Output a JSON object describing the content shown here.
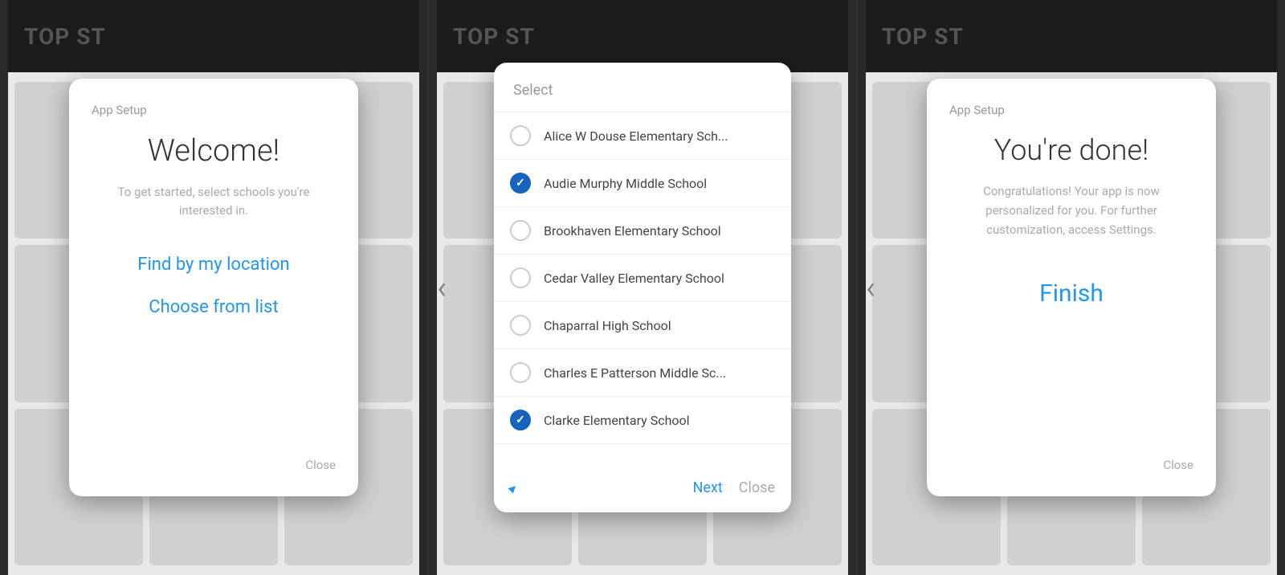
{
  "panel1": {
    "header": "App Setup",
    "title": "Welcome!",
    "subtitle": "To get started, select schools\nyou're interested in.",
    "find_location": "Find by my location",
    "choose_list": "Choose from list",
    "close": "Close"
  },
  "panel2": {
    "header": "Select",
    "schools": [
      {
        "name": "Alice W Douse Elementary Sch...",
        "checked": false
      },
      {
        "name": "Audie Murphy Middle School",
        "checked": true
      },
      {
        "name": "Brookhaven Elementary School",
        "checked": false
      },
      {
        "name": "Cedar Valley Elementary School",
        "checked": false
      },
      {
        "name": "Chaparral High School",
        "checked": false
      },
      {
        "name": "Charles E Patterson Middle Sc...",
        "checked": false
      },
      {
        "name": "Clarke Elementary School",
        "checked": true
      }
    ],
    "next": "Next",
    "close": "Close"
  },
  "panel3": {
    "header": "App Setup",
    "title": "You're done!",
    "subtitle": "Congratulations! Your app is now personalized for you. For further customization, access Settings.",
    "finish": "Finish",
    "close": "Close"
  },
  "bg": {
    "top_text": "TOP ST"
  }
}
